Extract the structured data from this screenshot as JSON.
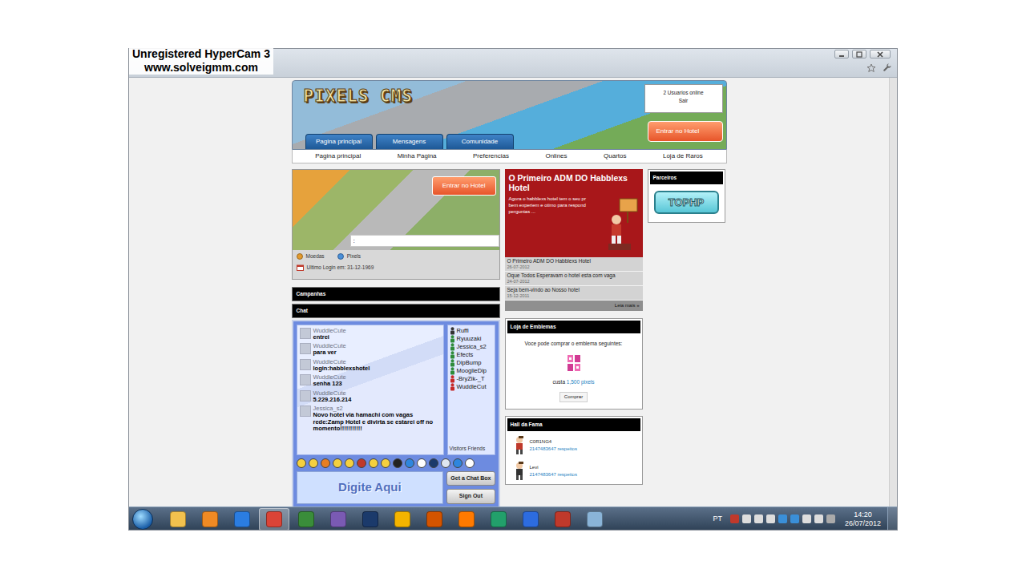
{
  "recorder": {
    "title": "Unregistered HyperCam 3",
    "url": "www.solveigmm.com"
  },
  "site": {
    "logo": "PIXELS CMS",
    "header_tabs": [
      "Pagina principal",
      "Mensagens",
      "Comunidade"
    ],
    "online": {
      "count": "2 Usuarios online",
      "logout": "Sair"
    },
    "enter_button": "Entrar no Hotel",
    "nav": [
      "Pagina principal",
      "Minha Pagina",
      "Preferencias",
      "Onlines",
      "Quartos",
      "Loja de Raros"
    ]
  },
  "hotel_box": {
    "button": "Entrar no Hotel",
    "motto": ":",
    "coins": "Moedas",
    "pixels": "Pixels",
    "last_login": "Ultimo Login em: 31-12-1969"
  },
  "left_sections": [
    "Campanhas",
    "Chat"
  ],
  "chat": {
    "messages": [
      {
        "user": "WuddleCute",
        "text": "entrei"
      },
      {
        "user": "WuddleCute",
        "text": "para ver"
      },
      {
        "user": "WuddleCute",
        "text": "login:habblexshotel"
      },
      {
        "user": "WuddleCute",
        "text": "senha 123"
      },
      {
        "user": "WuddleCute",
        "text": "5.229.216.214"
      },
      {
        "user": "Jessica_s2",
        "text": "Novo hotel via hamachi com vagas rede:Zamp Hotel e divirta se estarei off no momento!!!!!!!!!!!"
      }
    ],
    "users": [
      {
        "name": "Ruffi",
        "color": "#333333"
      },
      {
        "name": "Ryuuzaki",
        "color": "#2e8b3a"
      },
      {
        "name": "Jessica_s2",
        "color": "#2e8b3a"
      },
      {
        "name": "Efects",
        "color": "#2e8b3a"
      },
      {
        "name": "DipBump",
        "color": "#2e8b3a"
      },
      {
        "name": "MooglieDip",
        "color": "#2e8b3a"
      },
      {
        "name": "-BryZik-_T",
        "color": "#c62828"
      },
      {
        "name": "WuddleCut",
        "color": "#c62828"
      }
    ],
    "users_label": "Visitors Friends",
    "input_label": "Digite Aqui",
    "buttons": [
      "Get a Chat Box",
      "Sign Out"
    ]
  },
  "news": {
    "title": "O Primeiro ADM DO Habblexs Hotel",
    "summary": [
      "Agora o habblexs hotel tem o seu pr",
      "bem experiem e otimo para respond",
      "perguntas ..."
    ],
    "items": [
      {
        "title": "O Primeiro ADM DO Habblexs Hotel",
        "date": "26-07-2012"
      },
      {
        "title": "Oque Todos Esperavam o hotel esta com vaga",
        "date": "24-07-2012"
      },
      {
        "title": "Seja bem-vindo ao Nosso hotel",
        "date": "15-12-2011"
      }
    ],
    "more": "Leia mais »"
  },
  "badge_shop": {
    "title": "Loja de Emblemas",
    "text": "Voce pode comprar o emblema seguintes:",
    "price_label": "custa",
    "price": "1,500 pixels",
    "button": "Comprar"
  },
  "hall_of_fame": {
    "title": "Hall da Fama",
    "entries": [
      {
        "name": "C0R1NG4",
        "respects": "2147483647 respeitos"
      },
      {
        "name": "Levi",
        "respects": "2147483647 respeitos"
      }
    ]
  },
  "partners": {
    "title": "Parceiros",
    "logo": "TOPHP"
  },
  "taskbar": {
    "language": "PT",
    "time": "14:20",
    "date": "26/07/2012"
  }
}
